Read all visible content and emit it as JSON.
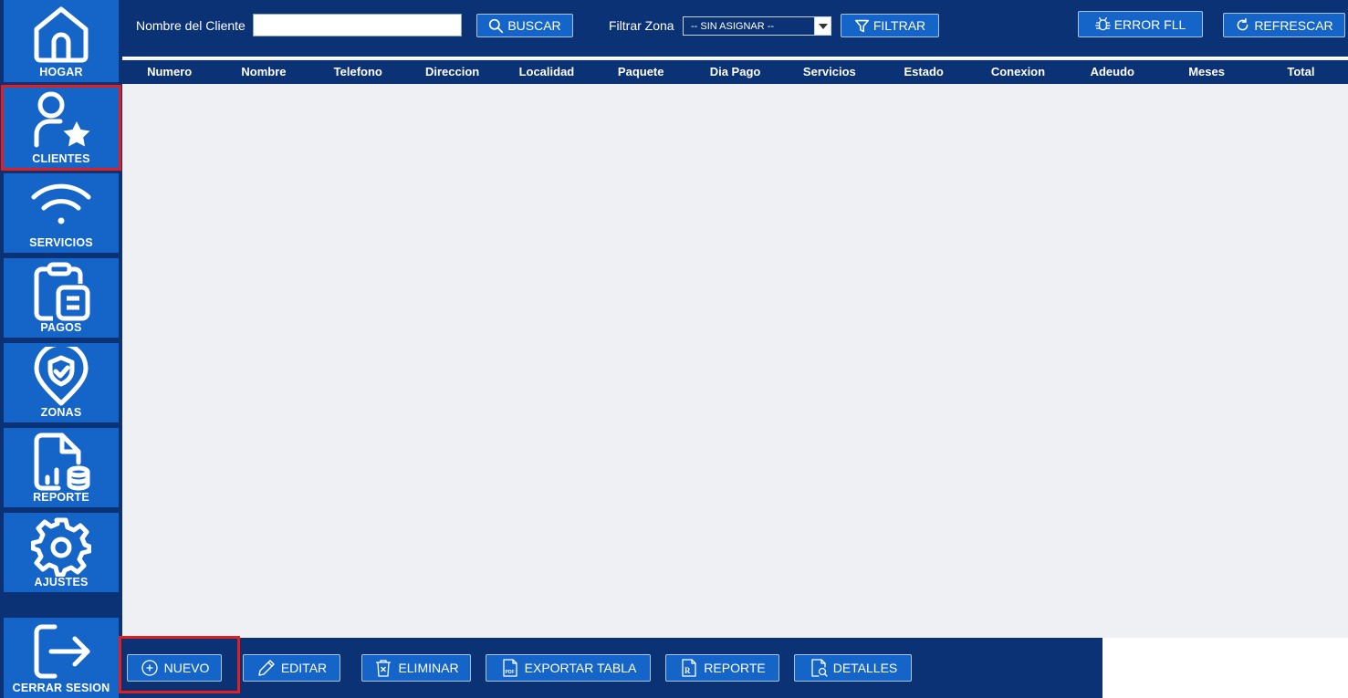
{
  "sidebar": {
    "items": [
      {
        "label": "HOGAR",
        "icon": "home-icon"
      },
      {
        "label": "CLIENTES",
        "icon": "user-star-icon",
        "active": true
      },
      {
        "label": "SERVICIOS",
        "icon": "wifi-icon"
      },
      {
        "label": "PAGOS",
        "icon": "clipboard-icon"
      },
      {
        "label": "ZONAS",
        "icon": "location-check-icon"
      },
      {
        "label": "REPORTE",
        "icon": "report-icon"
      },
      {
        "label": "AJUSTES",
        "icon": "gear-icon"
      },
      {
        "label": "CERRAR SESION",
        "icon": "logout-icon"
      }
    ]
  },
  "toolbar": {
    "client_name_label": "Nombre del Cliente",
    "search_value": "",
    "search_button": "BUSCAR",
    "zone_label": "Filtrar Zona",
    "zone_selected": "-- SIN ASIGNAR --",
    "filter_button": "FILTRAR",
    "error_button": "ERROR FLL",
    "refresh_button": "REFRESCAR"
  },
  "table": {
    "columns": [
      "Numero",
      "Nombre",
      "Telefono",
      "Direccion",
      "Localidad",
      "Paquete",
      "Dia Pago",
      "Servicios",
      "Estado",
      "Conexion",
      "Adeudo",
      "Meses",
      "Total"
    ],
    "rows": []
  },
  "actions": {
    "new": "NUEVO",
    "edit": "EDITAR",
    "delete": "ELIMINAR",
    "export": "EXPORTAR TABLA",
    "report": "REPORTE",
    "details": "DETALLES"
  },
  "colors": {
    "navy": "#0b3275",
    "blue": "#1565c8",
    "table_bg": "#eff0f4",
    "highlight": "#e02020"
  }
}
